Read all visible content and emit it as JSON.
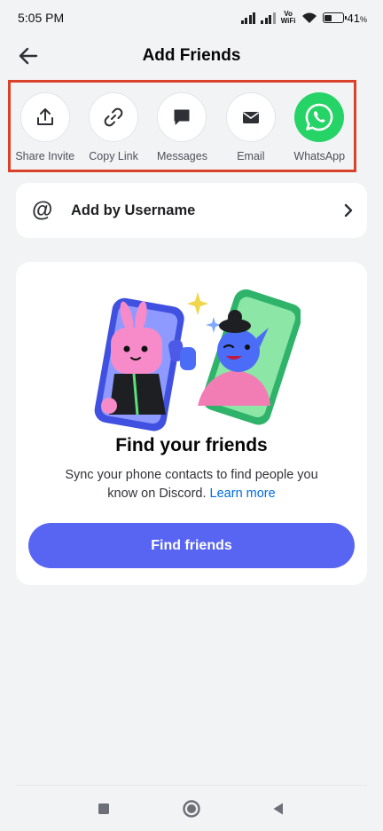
{
  "status_bar": {
    "time": "5:05 PM",
    "network_label": "Vo\nWiFi",
    "battery_text": "41",
    "battery_unit": "%"
  },
  "header": {
    "title": "Add Friends"
  },
  "share_options": [
    {
      "label": "Share Invite",
      "icon": "share-upload-icon"
    },
    {
      "label": "Copy Link",
      "icon": "link-icon"
    },
    {
      "label": "Messages",
      "icon": "message-bubble-icon"
    },
    {
      "label": "Email",
      "icon": "envelope-icon"
    },
    {
      "label": "WhatsApp",
      "icon": "whatsapp-icon"
    }
  ],
  "username_row": {
    "icon_glyph": "@",
    "label": "Add by Username"
  },
  "find_friends_card": {
    "title": "Find your friends",
    "description": "Sync your phone contacts to find people you know on Discord.",
    "link_text": "Learn more",
    "button_label": "Find friends"
  },
  "colors": {
    "accent": "#5865f2",
    "whatsapp": "#25d366",
    "highlight_border": "#d9412b",
    "link": "#006ce7"
  }
}
